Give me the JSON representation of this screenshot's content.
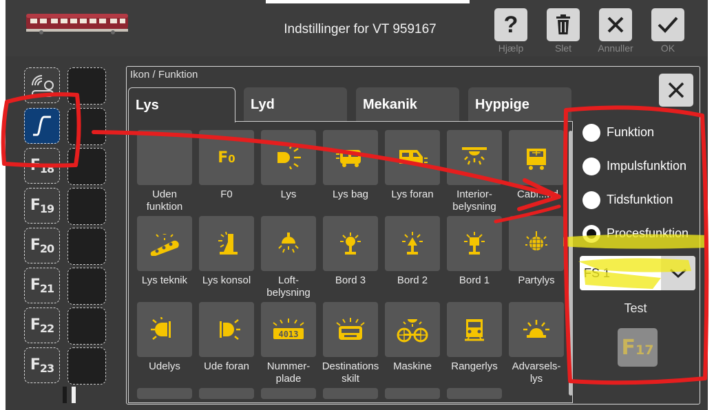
{
  "header": {
    "title": "Indstillinger for VT 959167",
    "buttons": [
      {
        "key": "help",
        "label": "Hjælp",
        "icon": "question-icon"
      },
      {
        "key": "delete",
        "label": "Slet",
        "icon": "trash-icon"
      },
      {
        "key": "cancel",
        "label": "Annuller",
        "icon": "close-icon"
      },
      {
        "key": "ok",
        "label": "OK",
        "icon": "check-icon"
      }
    ]
  },
  "left_functions": [
    {
      "icon": "radio-signal-icon"
    },
    {
      "icon": "process-curve-icon",
      "selected": true
    },
    {
      "label": "F",
      "sub": "18"
    },
    {
      "label": "F",
      "sub": "19"
    },
    {
      "label": "F",
      "sub": "20"
    },
    {
      "label": "F",
      "sub": "21"
    },
    {
      "label": "F",
      "sub": "22"
    },
    {
      "label": "F",
      "sub": "23"
    }
  ],
  "panel": {
    "title": "Ikon / Funktion",
    "tabs": [
      "Lys",
      "Lyd",
      "Mekanik",
      "Hyppige"
    ],
    "active_tab": "Lys",
    "icons": [
      {
        "label": "Uden\nfunktion",
        "icon": "none"
      },
      {
        "label": "F0",
        "icon": "f0-icon"
      },
      {
        "label": "Lys",
        "icon": "headlight-icon"
      },
      {
        "label": "Lys bag",
        "icon": "rear-light-icon"
      },
      {
        "label": "Lys foran",
        "icon": "front-light-icon"
      },
      {
        "label": "Interior-\nbelysning",
        "icon": "interior-light-icon"
      },
      {
        "label": "Cab light",
        "icon": "cab-light-icon"
      },
      {
        "label": "Lys teknik",
        "icon": "engine-light-icon"
      },
      {
        "label": "Lys konsol",
        "icon": "console-light-icon"
      },
      {
        "label": "Loft-\nbelysning",
        "icon": "ceiling-light-icon"
      },
      {
        "label": "Bord 3",
        "icon": "table-lamp-icon"
      },
      {
        "label": "Bord 2",
        "icon": "table-lamp-icon"
      },
      {
        "label": "Bord 1",
        "icon": "table-lamp-icon"
      },
      {
        "label": "Partylys",
        "icon": "disco-ball-icon"
      },
      {
        "label": "Udelys",
        "icon": "outdoor-light-icon"
      },
      {
        "label": "Ude foran",
        "icon": "outdoor-front-light-icon"
      },
      {
        "label": "Nummer-\nplade",
        "icon": "number-plate-icon"
      },
      {
        "label": "Destinations\nskilt",
        "icon": "destination-sign-icon"
      },
      {
        "label": "Maskine",
        "icon": "engine-wheels-icon"
      },
      {
        "label": "Rangerlys",
        "icon": "shunting-light-icon"
      },
      {
        "label": "Advarsels-\nlys",
        "icon": "warning-light-icon"
      }
    ],
    "number_plate_text": "4013",
    "cab_light_label_visible": "Cabl...nd"
  },
  "options": {
    "radios": [
      {
        "label": "Funktion",
        "selected": false
      },
      {
        "label": "Impulsfunktion",
        "selected": false
      },
      {
        "label": "Tidsfunktion",
        "selected": false
      },
      {
        "label": "Procesfunktion",
        "selected": true
      }
    ],
    "dropdown_value": "FS 1",
    "test_label": "Test",
    "test_button": {
      "label": "F",
      "sub": "17"
    }
  },
  "colors": {
    "accent_icon": "#f5c400",
    "selected_blue": "#0e3f78",
    "annotation_red": "#e51e1e",
    "highlight_yellow": "#f2ea1a"
  }
}
